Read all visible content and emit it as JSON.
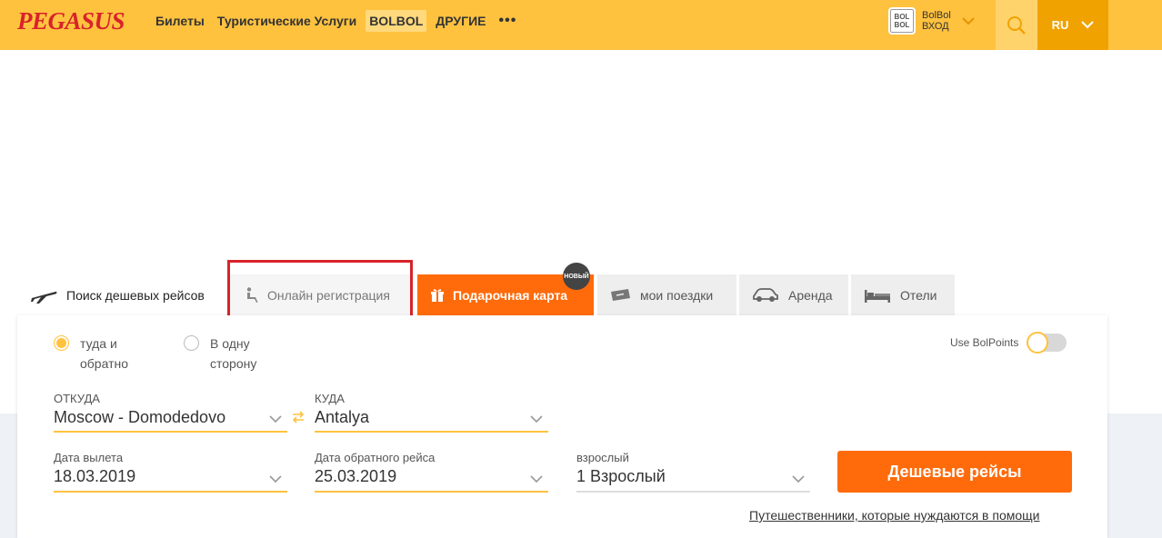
{
  "header": {
    "logo": "PEGASUS",
    "nav": [
      "Билеты",
      "Туристические Услуги",
      "BOLBOL",
      "ДРУГИЕ"
    ],
    "more": "•••",
    "bolbol_logo_top": "BOL",
    "bolbol_logo_bottom": "BOL",
    "bolbol_line1": "BolBol",
    "bolbol_line2": "ВХОД",
    "lang": "RU"
  },
  "tabs": {
    "search": "Поиск дешевых рейсов",
    "checkin": "Онлайн регистрация",
    "gift": "Подарочная карта",
    "badge": "НОВЫЙ",
    "trips": "мои поездки",
    "rent": "Аренда",
    "hotels": "Отели"
  },
  "form": {
    "roundtrip_line1": "туда и",
    "roundtrip_line2": "обратно",
    "oneway_line1": "В одну",
    "oneway_line2": "сторону",
    "use_bolpoints": "Use BolPoints",
    "from_label": "ОТКУДА",
    "from_value": "Moscow - Domodedovo",
    "to_label": "КУДА",
    "to_value": "Antalya",
    "depart_label": "Дата вылета",
    "depart_value": "18.03.2019",
    "return_label": "Дата обратного рейса",
    "return_value": "25.03.2019",
    "pax_label": "взрослый",
    "pax_value": "1 Взрослый",
    "submit": "Дешевые рейсы",
    "assist_link": "Путешественники, которые нуждаются в помощи"
  },
  "colors": {
    "brand_yellow": "#ffc23f",
    "brand_orange": "#ff6b0b",
    "logo_red": "#d8232a"
  }
}
